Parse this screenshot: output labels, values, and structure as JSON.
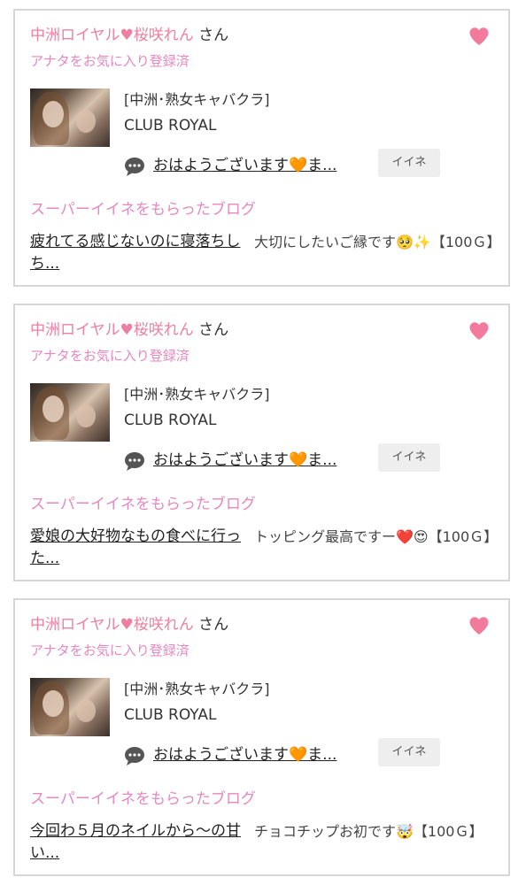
{
  "cards": [
    {
      "cast_name": "中洲ロイヤル♥桜咲れん",
      "honorific": "さん",
      "favorite_status": "アナタをお気に入り登録済",
      "shop_genre": "[中洲･熟女キャバクラ]",
      "shop_name": "CLUB ROYAL",
      "message": "おはようございます🧡ま...",
      "iine_label": "イイネ",
      "blog_heading": "スーパーイイネをもらったブログ",
      "blog_title": "疲れてる感じないのに寝落ちしち...",
      "blog_comment": "大切にしたいご縁です🥺✨【100Ｇ】"
    },
    {
      "cast_name": "中洲ロイヤル♥桜咲れん",
      "honorific": "さん",
      "favorite_status": "アナタをお気に入り登録済",
      "shop_genre": "[中洲･熟女キャバクラ]",
      "shop_name": "CLUB ROYAL",
      "message": "おはようございます🧡ま...",
      "iine_label": "イイネ",
      "blog_heading": "スーパーイイネをもらったブログ",
      "blog_title": "愛娘の大好物なもの食べに行った...",
      "blog_comment": "トッピング最高ですー❤️😍【100Ｇ】"
    },
    {
      "cast_name": "中洲ロイヤル♥桜咲れん",
      "honorific": "さん",
      "favorite_status": "アナタをお気に入り登録済",
      "shop_genre": "[中洲･熟女キャバクラ]",
      "shop_name": "CLUB ROYAL",
      "message": "おはようございます🧡ま...",
      "iine_label": "イイネ",
      "blog_heading": "スーパーイイネをもらったブログ",
      "blog_title": "今回わ５月のネイルから〜の甘い...",
      "blog_comment": "チョコチップお初です🤯【100Ｇ】"
    }
  ],
  "icons": {
    "favorite": "heart-icon",
    "message": "chat-bubble-icon"
  },
  "colors": {
    "accent_pink": "#ee7fa0",
    "label_pink": "#e688be",
    "heart_pink": "#f27a9c",
    "chat_icon": "#555555",
    "card_border": "#d6d6d6",
    "button_bg": "#eeeeee"
  }
}
